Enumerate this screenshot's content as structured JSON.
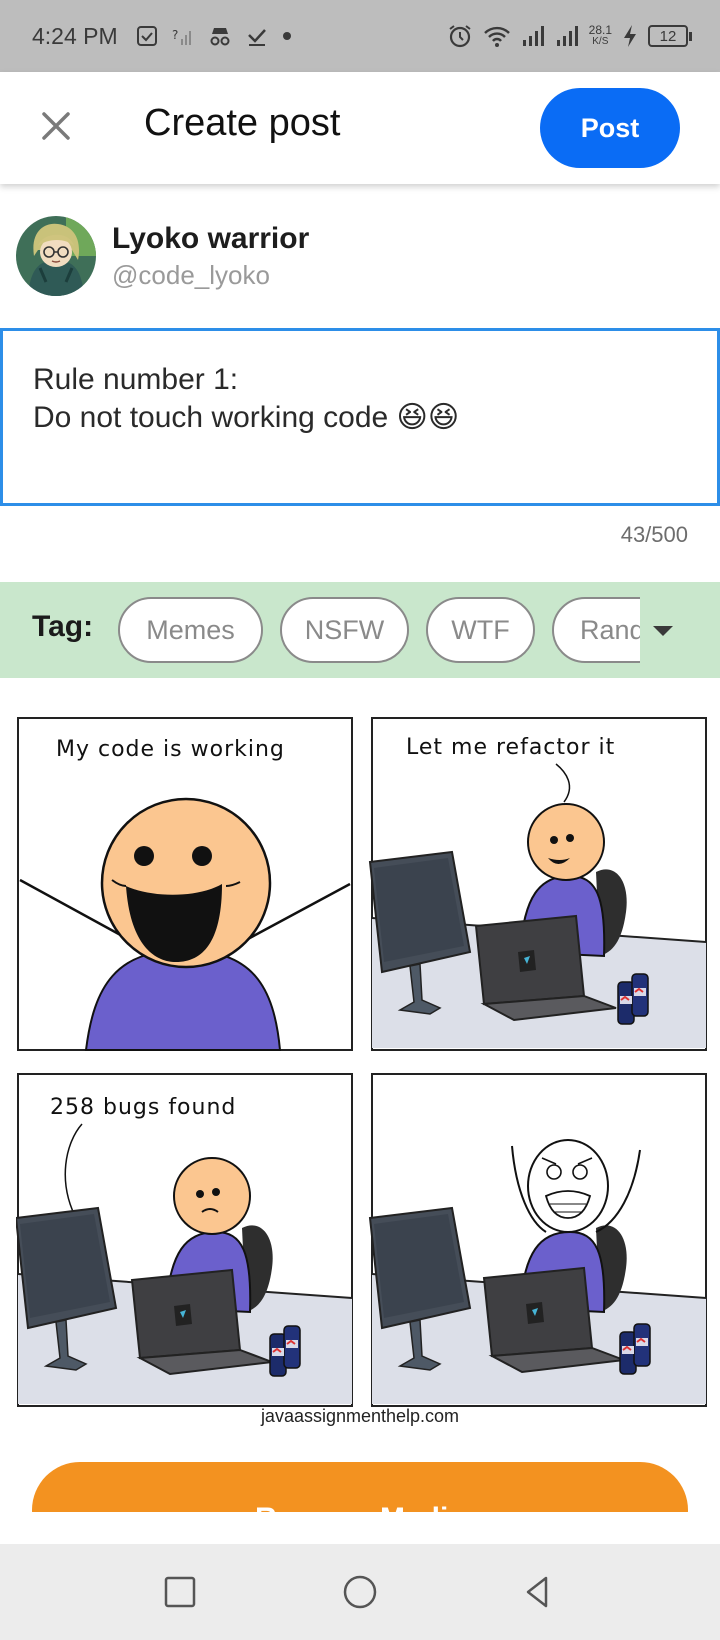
{
  "status_bar": {
    "time": "4:24 PM",
    "net_speed_value": "28.1",
    "net_speed_unit": "K/S",
    "battery": "12"
  },
  "header": {
    "title": "Create post",
    "post_label": "Post"
  },
  "user": {
    "name": "Lyoko warrior",
    "handle": "@code_lyoko"
  },
  "post": {
    "text": "Rule number 1:\nDo not touch working code 😆😆",
    "char_count": "43/500"
  },
  "tags": {
    "label": "Tag:",
    "items": [
      "Memes",
      "NSFW",
      "WTF",
      "Rand"
    ]
  },
  "comic": {
    "panel1_text": "My code is working",
    "panel2_text": "Let me refactor it",
    "panel3_text": "258 bugs found",
    "watermark": "javaassignmenthelp.com"
  },
  "actions": {
    "remove_media_label": "Remove Media"
  },
  "colors": {
    "accent_blue": "#0a6cf5",
    "tag_bar_bg": "#c9e7cc",
    "remove_orange": "#f39220",
    "focus_border": "#2d8ee8"
  },
  "icons": {
    "close": "close-icon",
    "dropdown": "chevron-down-icon",
    "nav_recent": "square-icon",
    "nav_home": "circle-icon",
    "nav_back": "triangle-back-icon"
  }
}
